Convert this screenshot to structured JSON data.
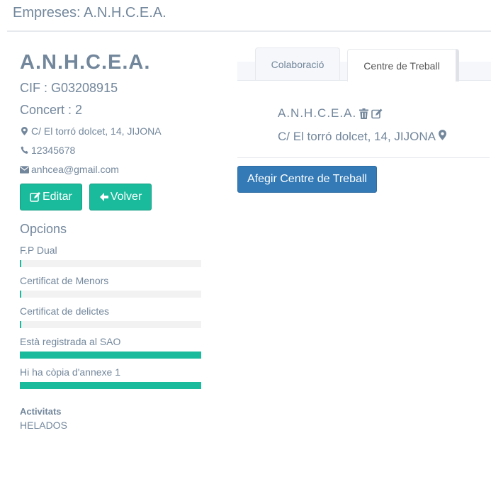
{
  "header": {
    "title": "Empreses: A.N.H.C.E.A."
  },
  "company": {
    "name": "A.N.H.C.E.A.",
    "cif": "CIF : G03208915",
    "concert": "Concert : 2",
    "address": "C/ El torró dolcet, 14, JIJONA",
    "phone": "12345678",
    "email": "anhcea@gmail.com"
  },
  "buttons": {
    "edit_label": "Editar",
    "back_label": "Volver"
  },
  "options": {
    "title": "Opcions",
    "items": [
      {
        "label": "F.P Dual",
        "progress": 0.01
      },
      {
        "label": "Certificat de Menors",
        "progress": 0.01
      },
      {
        "label": "Certificat de delictes",
        "progress": 0.01
      },
      {
        "label": "Està registrada al SAO",
        "progress": 1.0
      },
      {
        "label": "Hi ha còpia d'annexe 1",
        "progress": 1.0
      }
    ]
  },
  "activities": {
    "title": "Activitats",
    "value": "HELADOS"
  },
  "tabs": [
    {
      "label": "Colaboració",
      "active": false
    },
    {
      "label": "Centre de Treball",
      "active": true
    }
  ],
  "centre": {
    "name": "A.N.H.C.E.A.",
    "address": "C/ El torró dolcet, 14, JIJONA",
    "add_button_label": "Afegir Centre de Treball"
  },
  "colors": {
    "accent_green": "#1abb9c",
    "primary_blue": "#337ab7",
    "text": "#73879c"
  }
}
